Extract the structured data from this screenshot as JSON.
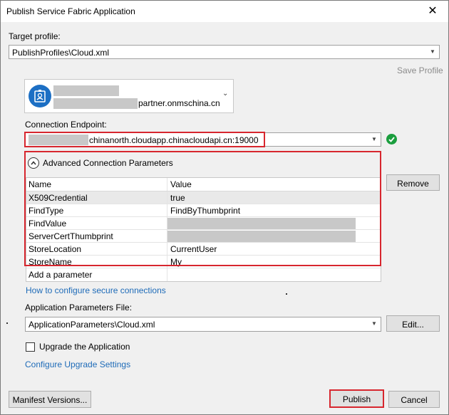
{
  "window": {
    "title": "Publish Service Fabric Application",
    "close_glyph": "✕"
  },
  "target_profile": {
    "label": "Target profile:",
    "value": "PublishProfiles\\Cloud.xml",
    "save_profile": "Save Profile"
  },
  "account": {
    "email_suffix": "partner.onmschina.cn",
    "icon": "account-badge-icon"
  },
  "connection": {
    "label": "Connection Endpoint:",
    "endpoint_visible": "chinanorth.cloudapp.chinacloudapi.cn:19000",
    "status_icon": "check-ok-icon",
    "status_color": "#1b9e3e"
  },
  "advanced": {
    "title": "Advanced Connection Parameters",
    "remove_button": "Remove",
    "columns": [
      "Name",
      "Value"
    ],
    "rows": [
      {
        "name": "X509Credential",
        "value": "true"
      },
      {
        "name": "FindType",
        "value": "FindByThumbprint"
      },
      {
        "name": "FindValue",
        "value": ""
      },
      {
        "name": "ServerCertThumbprint",
        "value": ""
      },
      {
        "name": "StoreLocation",
        "value": "CurrentUser"
      },
      {
        "name": "StoreName",
        "value": "My"
      }
    ],
    "add_parameter": "Add a parameter"
  },
  "secure_link": "How to configure secure connections",
  "app_params": {
    "label": "Application Parameters File:",
    "value": "ApplicationParameters\\Cloud.xml",
    "edit_button": "Edit..."
  },
  "upgrade": {
    "checkbox_label": "Upgrade the Application",
    "checked": false,
    "configure_link": "Configure Upgrade Settings"
  },
  "footer": {
    "manifest_button": "Manifest Versions...",
    "publish_button": "Publish",
    "cancel_button": "Cancel"
  },
  "colors": {
    "highlight_red": "#d7262e",
    "link_blue": "#1e6bb8"
  }
}
